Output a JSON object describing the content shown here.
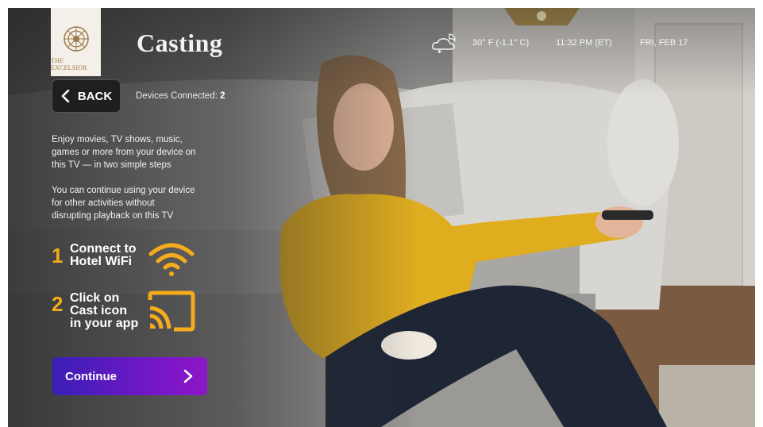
{
  "header": {
    "logo_text": "THE EXCELSIOR",
    "title": "Casting",
    "weather_icon": "night-cloud-icon",
    "temperature": "30° F (-1.1° C)",
    "time": "11:32 PM (ET)",
    "date": "FRI, FEB 17"
  },
  "nav": {
    "back_label": "BACK",
    "devices_label": "Devices Connected:",
    "devices_count": "2"
  },
  "content": {
    "intro_line1": "Enjoy movies, TV shows, music,",
    "intro_line2": "games or more from your device on",
    "intro_line3": "this TV — in two simple steps",
    "info_line1": "You can continue using your device",
    "info_line2": "for other activities without",
    "info_line3": "disrupting playback on this TV",
    "steps": [
      {
        "number": "1",
        "line1": "Connect to",
        "line2": "Hotel WiFi",
        "icon": "wifi-icon"
      },
      {
        "number": "2",
        "line1": "Click on",
        "line2": "Cast icon",
        "line3": "in your app",
        "icon": "cast-icon"
      }
    ],
    "continue_label": "Continue"
  },
  "colors": {
    "accent": "#f4ac1c",
    "button_gradient_start": "#3a1fb5",
    "button_gradient_end": "#8e16c9",
    "logo_bg": "#f4efe8"
  }
}
